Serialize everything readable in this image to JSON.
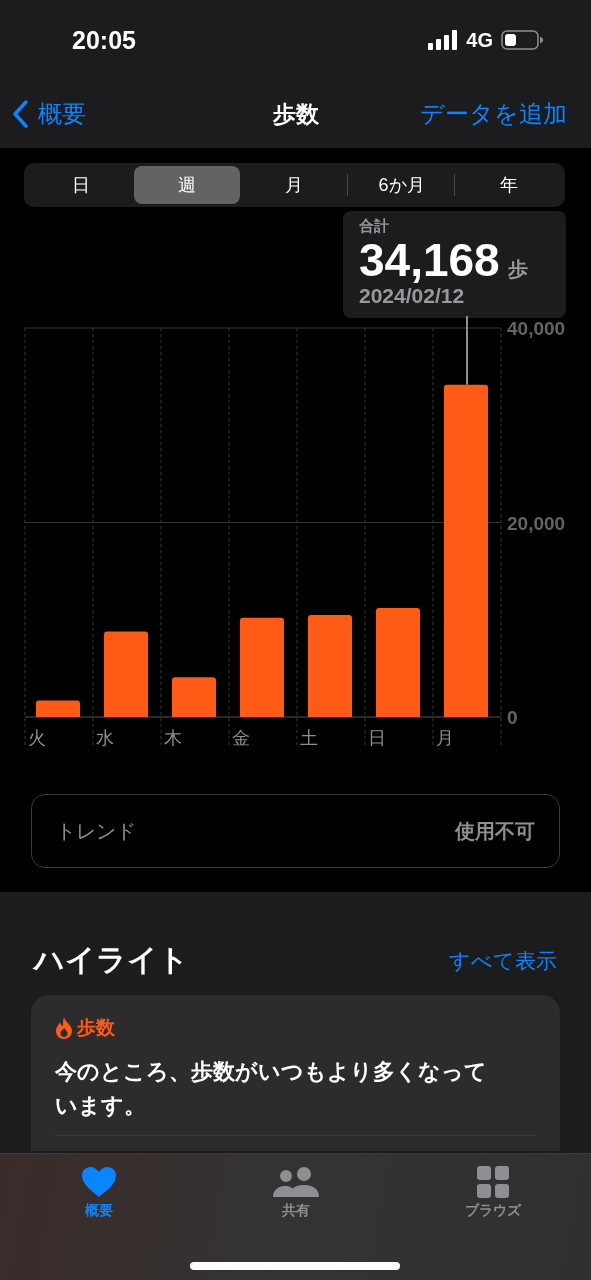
{
  "status_bar": {
    "time": "20:05",
    "network": "4G"
  },
  "nav": {
    "back": "概要",
    "title": "歩数",
    "action": "データを追加"
  },
  "segments": [
    {
      "label": "日",
      "selected": false
    },
    {
      "label": "週",
      "selected": true
    },
    {
      "label": "月",
      "selected": false
    },
    {
      "label": "6か月",
      "selected": false
    },
    {
      "label": "年",
      "selected": false
    }
  ],
  "summary": {
    "label": "合計",
    "value": "34,168",
    "unit": "歩",
    "date": "2024/02/12"
  },
  "chart_data": {
    "type": "bar",
    "categories": [
      "火",
      "水",
      "木",
      "金",
      "土",
      "日",
      "月"
    ],
    "series": [
      {
        "color": "#ff5a16",
        "values": [
          1700,
          8800,
          4100,
          10200,
          10500,
          11200,
          34168
        ]
      }
    ],
    "ylim": [
      0,
      40000
    ],
    "yticks": [
      {
        "value": 0,
        "label": "0"
      },
      {
        "value": 20000,
        "label": "20,000"
      },
      {
        "value": 40000,
        "label": "40,000"
      }
    ]
  },
  "trend": {
    "label": "トレンド",
    "value": "使用不可"
  },
  "highlights": {
    "title": "ハイライト",
    "see_all": "すべて表示",
    "card": {
      "category": "歩数",
      "text": "今のところ、歩数がいつもより多くなっています。"
    }
  },
  "tab_bar": [
    {
      "label": "概要",
      "selected": true
    },
    {
      "label": "共有",
      "selected": false
    },
    {
      "label": "ブラウズ",
      "selected": false
    }
  ]
}
